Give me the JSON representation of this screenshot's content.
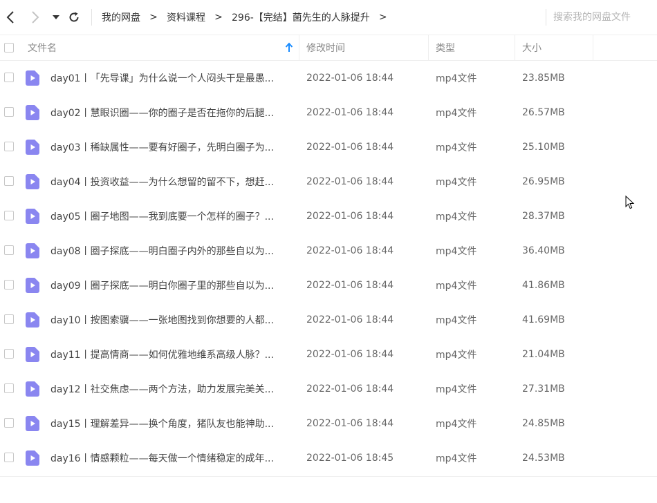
{
  "nav": {
    "back_icon": "chevron-left-icon",
    "forward_icon": "chevron-right-icon",
    "history_icon": "caret-down-icon",
    "refresh_icon": "refresh-icon"
  },
  "breadcrumb": {
    "items": [
      "我的网盘",
      "资料课程",
      "296-【完结】菌先生的人脉提升"
    ],
    "separator": ">"
  },
  "search": {
    "placeholder": "搜索我的网盘文件"
  },
  "columns": {
    "name": "文件名",
    "modified": "修改时间",
    "type": "类型",
    "size": "大小"
  },
  "sort": {
    "column": "name",
    "direction": "ascending",
    "icon": "arrow-up-icon"
  },
  "colors": {
    "accent": "#1a8cff",
    "file_icon": "#8a86f0",
    "divider": "#eeeeee"
  },
  "files": [
    {
      "name": "day01丨「先导课」为什么说一个人闷头干是最愚...",
      "modified": "2022-01-06 18:44",
      "type": "mp4文件",
      "size": "23.85MB"
    },
    {
      "name": "day02丨慧眼识圈——你的圈子是否在拖你的后腿...",
      "modified": "2022-01-06 18:44",
      "type": "mp4文件",
      "size": "26.57MB"
    },
    {
      "name": "day03丨稀缺属性——要有好圈子，先明白圈子为...",
      "modified": "2022-01-06 18:44",
      "type": "mp4文件",
      "size": "25.10MB"
    },
    {
      "name": "day04丨投资收益——为什么想留的留不下，想赶...",
      "modified": "2022-01-06 18:44",
      "type": "mp4文件",
      "size": "26.95MB"
    },
    {
      "name": "day05丨圈子地图——我到底要一个怎样的圈子？...",
      "modified": "2022-01-06 18:44",
      "type": "mp4文件",
      "size": "28.37MB"
    },
    {
      "name": "day08丨圈子探底——明白圈子内外的那些自以为...",
      "modified": "2022-01-06 18:44",
      "type": "mp4文件",
      "size": "36.40MB"
    },
    {
      "name": "day09丨圈子探底——明白你圈子里的那些自以为...",
      "modified": "2022-01-06 18:44",
      "type": "mp4文件",
      "size": "41.86MB"
    },
    {
      "name": "day10丨按图索骥——一张地图找到你想要的人都...",
      "modified": "2022-01-06 18:44",
      "type": "mp4文件",
      "size": "41.69MB"
    },
    {
      "name": "day11丨提高情商——如何优雅地维系高级人脉？...",
      "modified": "2022-01-06 18:44",
      "type": "mp4文件",
      "size": "21.04MB"
    },
    {
      "name": "day12丨社交焦虑——两个方法，助力发展完美关...",
      "modified": "2022-01-06 18:44",
      "type": "mp4文件",
      "size": "27.31MB"
    },
    {
      "name": "day15丨理解差异——换个角度，猪队友也能神助...",
      "modified": "2022-01-06 18:44",
      "type": "mp4文件",
      "size": "24.85MB"
    },
    {
      "name": "day16丨情感颗粒——每天做一个情绪稳定的成年...",
      "modified": "2022-01-06 18:45",
      "type": "mp4文件",
      "size": "24.53MB"
    }
  ]
}
